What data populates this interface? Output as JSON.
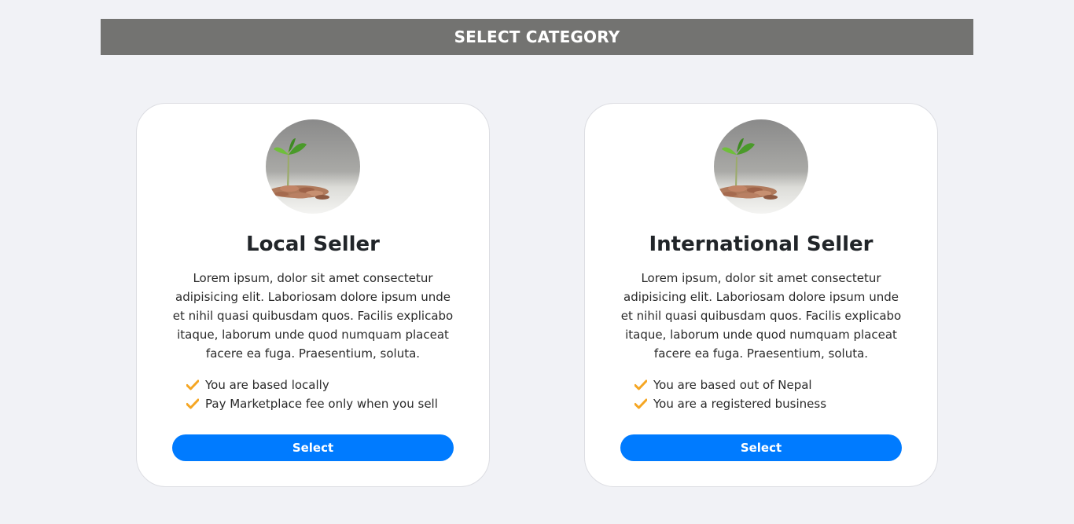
{
  "header": {
    "title": "SELECT CATEGORY"
  },
  "cards": [
    {
      "title": "Local Seller",
      "description": "Lorem ipsum, dolor sit amet consectetur adipisicing elit. Laboriosam dolore ipsum unde et nihil quasi quibusdam quos. Facilis explicabo itaque, laborum unde quod numquam placeat facere ea fuga. Praesentium, soluta.",
      "features": [
        "You are based locally",
        "Pay Marketplace fee only when you sell"
      ],
      "button_label": "Select"
    },
    {
      "title": "International Seller",
      "description": "Lorem ipsum, dolor sit amet consectetur adipisicing elit. Laboriosam dolore ipsum unde et nihil quasi quibusdam quos. Facilis explicabo itaque, laborum unde quod numquam placeat facere ea fuga. Praesentium, soluta.",
      "features": [
        "You are based out of Nepal",
        "You are a registered business"
      ],
      "button_label": "Select"
    }
  ],
  "colors": {
    "header_bg": "#737371",
    "button_bg": "#007bff",
    "check": "#f5a623",
    "page_bg": "#f1f2f6"
  },
  "icons": {
    "feature_icon": "check-icon",
    "avatar_image": "plant-coins-image"
  }
}
